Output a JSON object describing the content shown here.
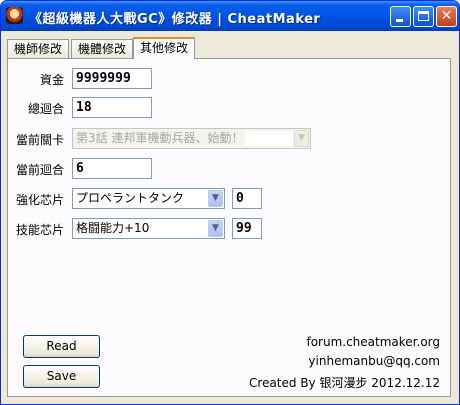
{
  "window": {
    "title": "《超級機器人大戰GC》修改器 | CheatMaker",
    "icon": "app-avatar-icon",
    "min_glyph": "",
    "close_glyph": "✕"
  },
  "tabs": [
    {
      "label": "機師修改",
      "selected": false
    },
    {
      "label": "機體修改",
      "selected": false
    },
    {
      "label": "其他修改",
      "selected": true
    }
  ],
  "form": {
    "money": {
      "label": "資金",
      "value": "9999999"
    },
    "total_turns": {
      "label": "總迴合",
      "value": "18"
    },
    "current_stage": {
      "label": "當前關卡",
      "value": "第3話  連邦軍機動兵器、始動！",
      "disabled": true
    },
    "current_turn": {
      "label": "當前迴合",
      "value": "6"
    },
    "enhance_chip": {
      "label": "強化芯片",
      "value": "プロペラントタンク",
      "count": "0"
    },
    "skill_chip": {
      "label": "技能芯片",
      "value": "格闘能力+10",
      "count": "99"
    }
  },
  "buttons": {
    "read": "Read",
    "save": "Save"
  },
  "info": {
    "forum": "forum.cheatmaker.org",
    "email": "yinhemanbu@qq.com",
    "credit": "Created By 银河漫步 2012.12.12"
  },
  "colors": {
    "titlebar": "#0054e3",
    "tab_highlight": "#e68b2c",
    "panel_bg": "#fcfcfe",
    "window_bg": "#ece9d8"
  }
}
